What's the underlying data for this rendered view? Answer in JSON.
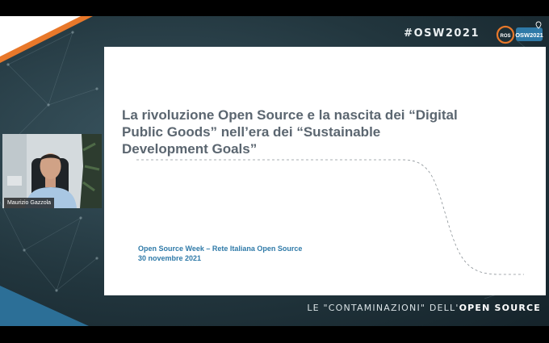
{
  "header": {
    "hashtag": "#OSW2021",
    "logo": {
      "left_text": "ROS",
      "right_text": "OSW2021",
      "icon": "location-pin-icon"
    }
  },
  "slide": {
    "title_lines": [
      "La rivoluzione Open Source e la nascita dei “Digital",
      "Public Goods” nell’era dei “Sustainable",
      "Development Goals”"
    ],
    "subtitle": "Open Source Week – Rete Italiana Open Source",
    "date": "30 novembre 2021"
  },
  "speaker": {
    "name": "Maurizio Gazzola"
  },
  "footer": {
    "tagline_prefix": "LE \"CONTAMINAZIONI\" DELL'",
    "tagline_strong": "OPEN SOURCE"
  },
  "colors": {
    "accent_orange": "#e8782a",
    "accent_blue": "#2f7aa8",
    "title_gray": "#5b6670"
  }
}
